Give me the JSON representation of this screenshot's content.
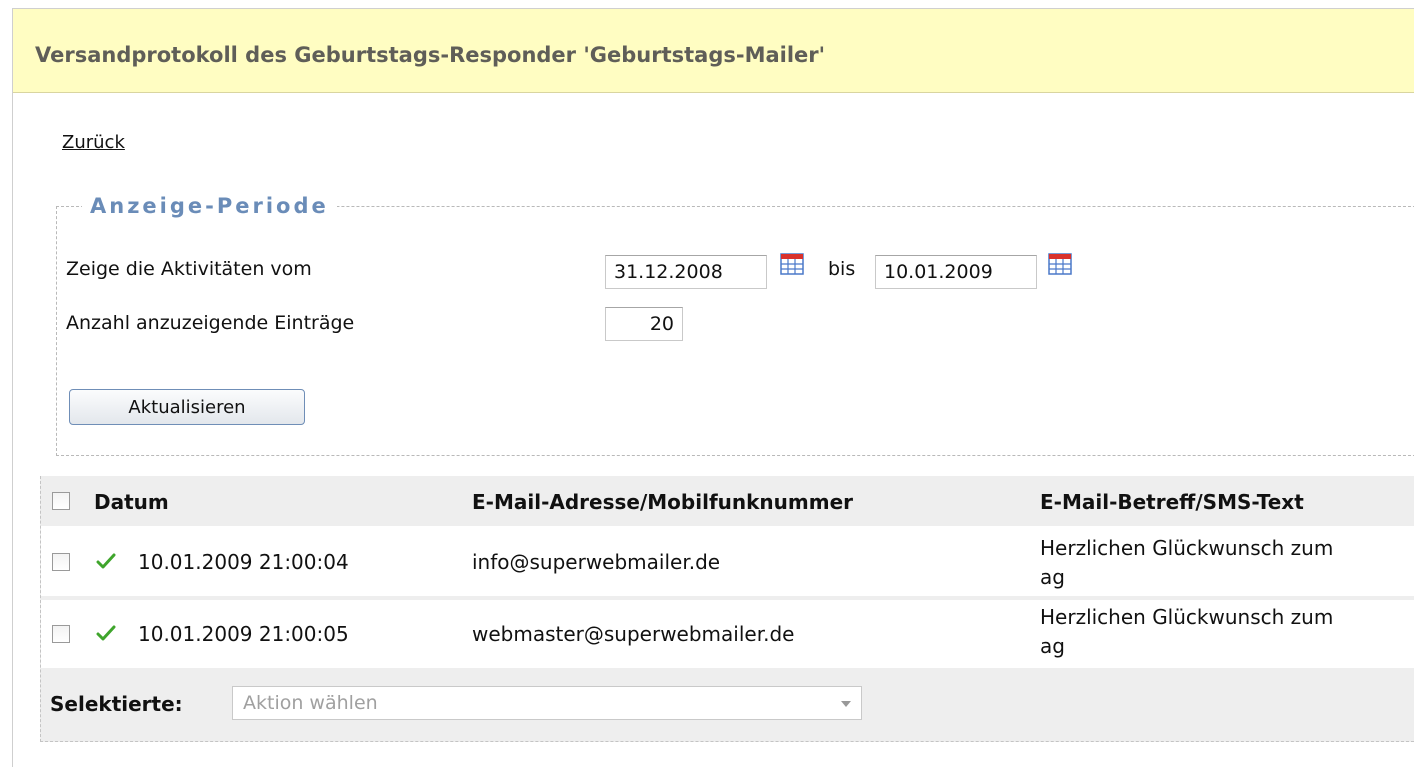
{
  "header": {
    "title": "Versandprotokoll des Geburtstags-Responder 'Geburtstags-Mailer'"
  },
  "nav": {
    "back_label": "Zurück"
  },
  "period": {
    "legend": "Anzeige-Periode",
    "from_label": "Zeige die Aktivitäten vom",
    "from_value": "31.12.2008",
    "to_label": "bis",
    "to_value": "10.01.2009",
    "count_label": "Anzahl anzuzeigende Einträge",
    "count_value": "20",
    "calendar_icon": "calendar-icon",
    "update_button": "Aktualisieren"
  },
  "table": {
    "headers": {
      "date": "Datum",
      "recipient": "E-Mail-Adresse/Mobilfunknummer",
      "subject": "E-Mail-Betreff/SMS-Text"
    },
    "status_icon": "checkmark-icon",
    "rows": [
      {
        "date": "10.01.2009 21:00:04",
        "recipient": "info@superwebmailer.de",
        "subject_line1": "Herzlichen Glückwunsch zum",
        "subject_line2": "ag"
      },
      {
        "date": "10.01.2009 21:00:05",
        "recipient": "webmaster@superwebmailer.de",
        "subject_line1": "Herzlichen Glückwunsch zum",
        "subject_line2": "ag"
      }
    ]
  },
  "footer": {
    "selected_label": "Selektierte:",
    "action_placeholder": "Aktion wählen"
  },
  "colors": {
    "header_bg": "#fffdc2",
    "legend_text": "#6a8cb8",
    "check_green": "#3fa52c",
    "calendar_red": "#d9312b",
    "calendar_blue": "#4a78c9"
  }
}
